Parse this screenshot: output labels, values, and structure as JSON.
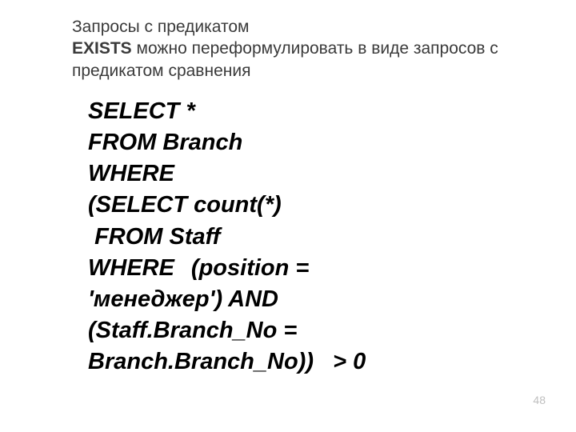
{
  "header": {
    "line1": "Запросы с предикатом",
    "exists": "EXISTS",
    "line2_rest": " можно переформулировать в виде запросов с предикатом сравнения"
  },
  "code": {
    "l1": "SELECT *",
    "l2": "FROM Branch",
    "l3": "WHERE",
    "l4": "(SELECT count(*)",
    "l5": " FROM Staff",
    "l6": "WHERE\t(position = 'менеджер') AND",
    "l7": "(Staff.Branch_No = Branch.Branch_No))   > 0"
  },
  "pageNumber": "48"
}
